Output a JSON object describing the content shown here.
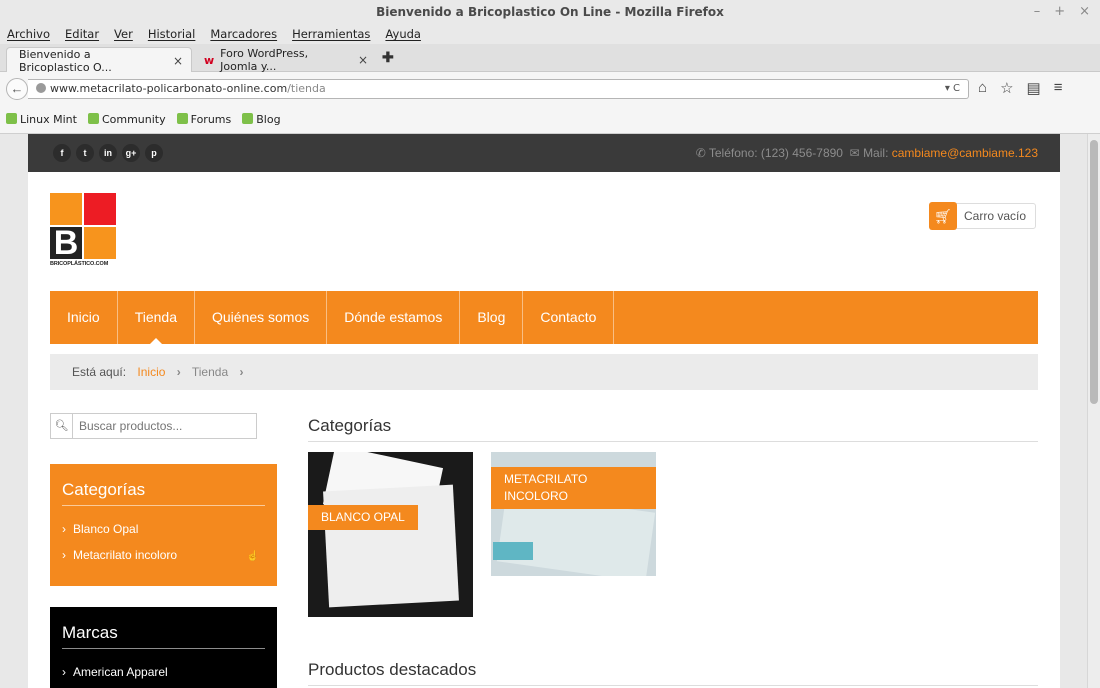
{
  "window": {
    "title": "Bienvenido a Bricoplastico On Line - Mozilla Firefox",
    "controls": [
      "–",
      "+",
      "×"
    ]
  },
  "menubar": [
    "Archivo",
    "Editar",
    "Ver",
    "Historial",
    "Marcadores",
    "Herramientas",
    "Ayuda"
  ],
  "tabs": [
    {
      "label": "Bienvenido a Bricoplastico O...",
      "close": "×",
      "active": true
    },
    {
      "label": "Foro WordPress, Joomla y...",
      "close": "×",
      "favicon": "w",
      "active": false
    }
  ],
  "new_tab": "✚",
  "urlbar": {
    "domain": "www.metacrilato-policarbonato-online.com",
    "path": "/tienda",
    "right_icons": "▾ C"
  },
  "nav_icons": [
    "home-icon",
    "star-icon",
    "reading-list-icon",
    "menu-icon"
  ],
  "bookmarks": [
    "Linux Mint",
    "Community",
    "Forums",
    "Blog"
  ],
  "site": {
    "socials": [
      "f",
      "t",
      "in",
      "g+",
      "p"
    ],
    "phone_label": "Teléfono: (123) 456-7890",
    "mail_label": "Mail:",
    "mail_value": "cambiame@cambiame.123",
    "logo_letter": "B",
    "logo_text": "BRICOPLÁSTICO.COM",
    "cart_label": "Carro vacío",
    "nav": [
      {
        "label": "Inicio"
      },
      {
        "label": "Tienda",
        "active": true
      },
      {
        "label": "Quiénes somos"
      },
      {
        "label": "Dónde estamos"
      },
      {
        "label": "Blog"
      },
      {
        "label": "Contacto"
      }
    ],
    "breadcrumb": {
      "prefix": "Está aquí:",
      "home": "Inicio",
      "current": "Tienda",
      "sep": "›"
    },
    "search_placeholder": "Buscar productos...",
    "categories_box": {
      "title": "Categorías",
      "items": [
        "Blanco Opal",
        "Metacrilato incoloro"
      ]
    },
    "brands_box": {
      "title": "Marcas",
      "items": [
        "American Apparel"
      ]
    },
    "main_categories_title": "Categorías",
    "category_cards": [
      {
        "label": "BLANCO OPAL"
      },
      {
        "label": "METACRILATO INCOLORO"
      }
    ],
    "featured_title": "Productos destacados"
  },
  "colors": {
    "accent": "#f4891e",
    "topbar": "#3a3a3a",
    "brand_red": "#ed1c24"
  }
}
